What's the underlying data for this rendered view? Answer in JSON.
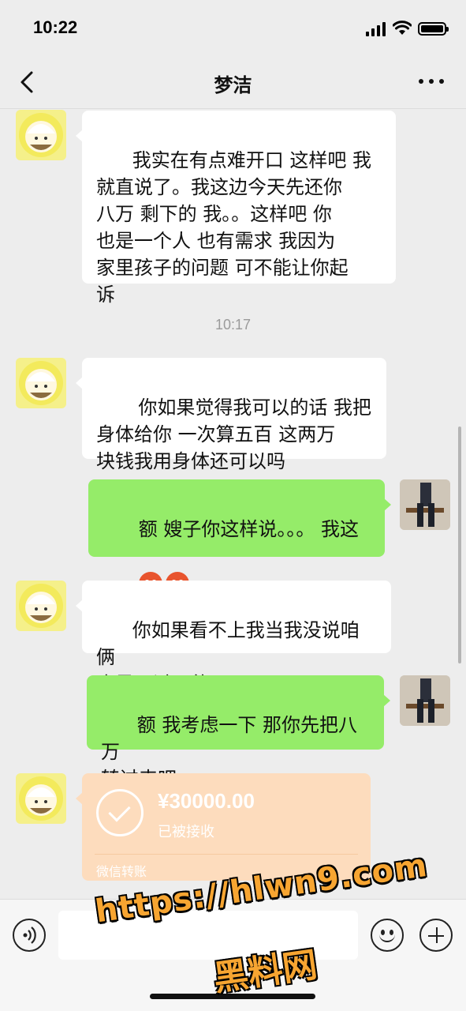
{
  "status_bar": {
    "time": "10:22"
  },
  "header": {
    "title": "梦洁"
  },
  "messages": [
    {
      "side": "left",
      "text": "我实在有点难开口 这样吧 我\n就直说了。我这边今天先还你\n八万 剩下的 我。。这样吧 你\n也是一个人 也有需求 我因为\n家里孩子的问题 可不能让你起\n诉"
    },
    {
      "side": "left",
      "text": " 你如果觉得我可以的话 我把\n身体给你 一次算五百 这两万\n块钱我用身体还可以吗"
    },
    {
      "side": "right",
      "text": "额 嫂子你这样说。。。 我这"
    },
    {
      "side": "left",
      "text": "你如果看不上我当我没说咱俩\n也是见过面的"
    },
    {
      "side": "right",
      "text": "额 我考虑一下 那你先把八万\n转过来吧"
    }
  ],
  "timestamp": "10:17",
  "transfer": {
    "amount": "¥30000.00",
    "status": "已被接收",
    "label": "微信转账"
  },
  "input": {
    "placeholder": ""
  },
  "watermark": {
    "url": "https://hlwn9.com",
    "name": "黑料网"
  },
  "colors": {
    "my_bubble": "#95ec69",
    "their_bubble": "#ffffff",
    "transfer_card": "#fddcbd",
    "background": "#ededed",
    "watermark": "#f7a531"
  },
  "icons": [
    "signal-icon",
    "wifi-icon",
    "battery-icon",
    "back-icon",
    "more-icon",
    "voice-icon",
    "emoji-icon",
    "plus-icon",
    "check-icon"
  ]
}
